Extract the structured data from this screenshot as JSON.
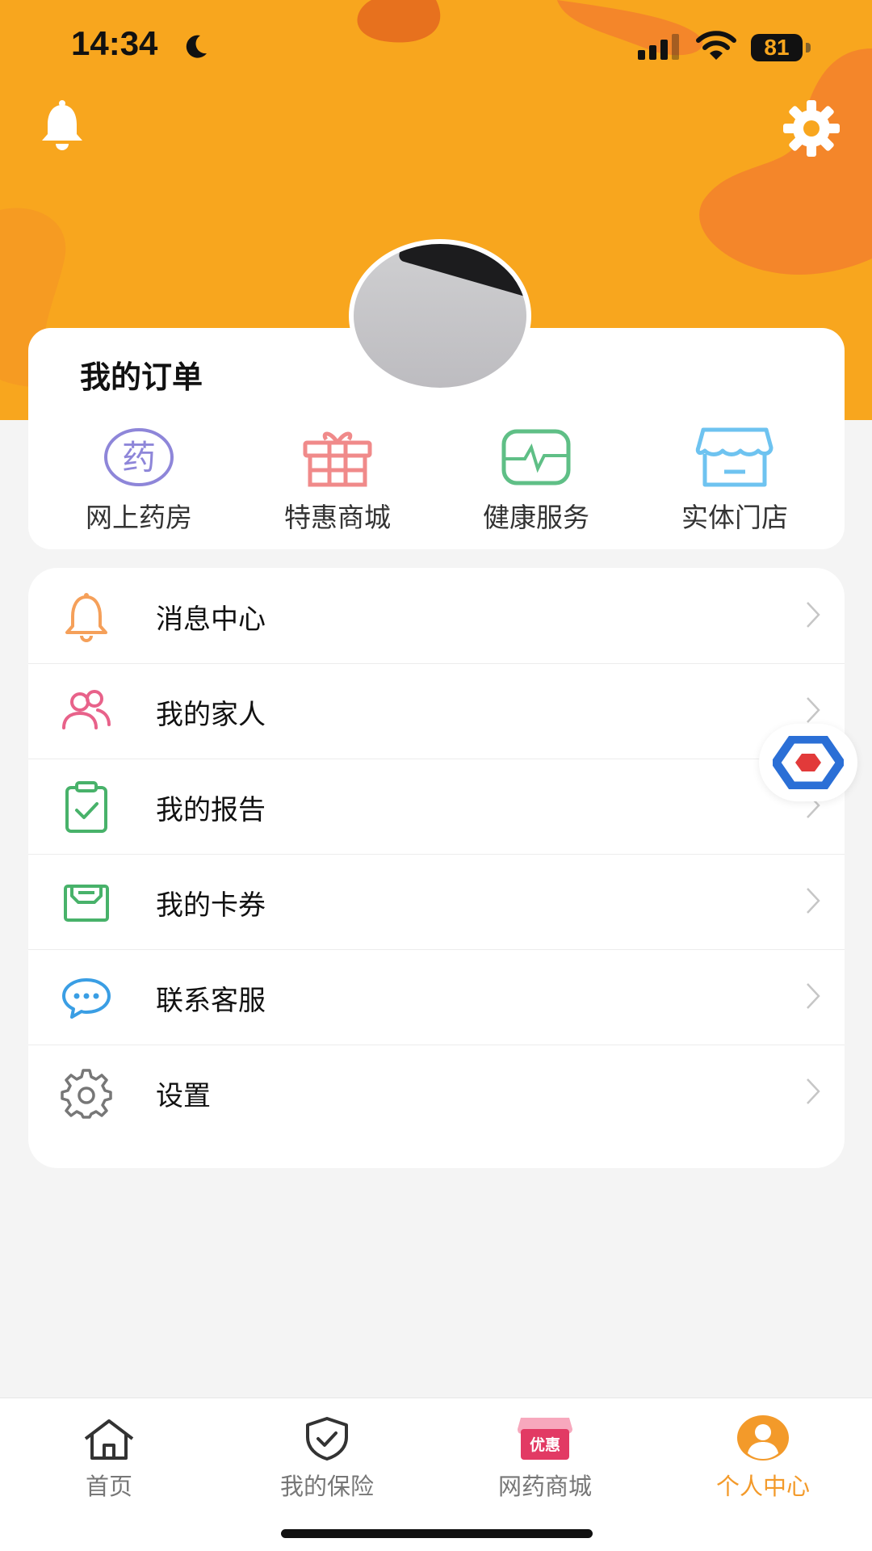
{
  "status_bar": {
    "time": "14:34",
    "battery": "81"
  },
  "orders": {
    "title": "我的订单",
    "items": [
      {
        "label": "网上药房",
        "icon": "pharmacy-icon",
        "glyph": "药",
        "color": "#8e86d9"
      },
      {
        "label": "特惠商城",
        "icon": "gift-icon",
        "color": "#f08a8a"
      },
      {
        "label": "健康服务",
        "icon": "health-monitor-icon",
        "color": "#5fbf86"
      },
      {
        "label": "实体门店",
        "icon": "store-icon",
        "color": "#6ec3f0"
      }
    ]
  },
  "menu": {
    "items": [
      {
        "label": "消息中心",
        "icon": "bell-icon",
        "color": "#f5a05a"
      },
      {
        "label": "我的家人",
        "icon": "family-icon",
        "color": "#e8628a"
      },
      {
        "label": "我的报告",
        "icon": "report-icon",
        "color": "#48b26a"
      },
      {
        "label": "我的卡券",
        "icon": "coupon-icon",
        "color": "#48b26a"
      },
      {
        "label": "联系客服",
        "icon": "chat-icon",
        "color": "#3a9ee4"
      },
      {
        "label": "设置",
        "icon": "gear-icon",
        "color": "#777777"
      }
    ]
  },
  "tabs": [
    {
      "label": "首页",
      "icon": "home-icon",
      "active": false
    },
    {
      "label": "我的保险",
      "icon": "shield-icon",
      "active": false
    },
    {
      "label": "网药商城",
      "icon": "mall-icon",
      "badge": "优惠",
      "active": false
    },
    {
      "label": "个人中心",
      "icon": "person-icon",
      "active": true
    }
  ],
  "colors": {
    "accent": "#f8a61e",
    "active_tab": "#f39a2a",
    "blob": "#f4862a"
  }
}
